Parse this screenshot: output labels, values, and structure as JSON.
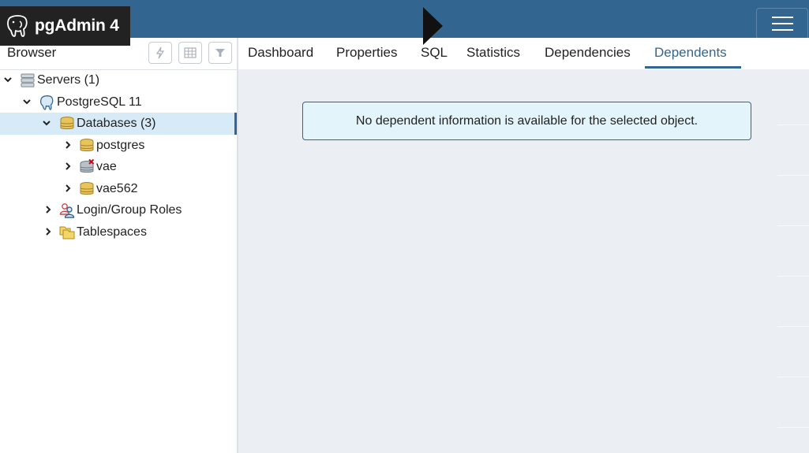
{
  "app": {
    "name": "pgAdmin 4",
    "logo_icon": "elephant-icon",
    "colors": {
      "header": "#326690",
      "brand_bg": "#222222",
      "selected_row": "#d6eaf8",
      "alert_bg": "#e4f4fb"
    }
  },
  "browser": {
    "title": "Browser",
    "toolbar": [
      {
        "name": "query-tool-button",
        "icon": "lightning-icon"
      },
      {
        "name": "view-data-button",
        "icon": "table-icon"
      },
      {
        "name": "filter-button",
        "icon": "filter-icon"
      }
    ],
    "tree": [
      {
        "label": "Servers (1)",
        "icon": "servers-icon",
        "expanded": true
      },
      {
        "label": "PostgreSQL 11",
        "icon": "postgres-server-icon",
        "expanded": true
      },
      {
        "label": "Databases (3)",
        "icon": "databases-icon",
        "expanded": true,
        "selected": true
      },
      {
        "label": "postgres",
        "icon": "database-icon",
        "expanded": false
      },
      {
        "label": "vae",
        "icon": "database-disconnected-icon",
        "expanded": false
      },
      {
        "label": "vae562",
        "icon": "database-icon",
        "expanded": false
      },
      {
        "label": "Login/Group Roles",
        "icon": "roles-icon",
        "expanded": false
      },
      {
        "label": "Tablespaces",
        "icon": "tablespaces-icon",
        "expanded": false
      }
    ]
  },
  "tabs": [
    {
      "label": "Dashboard"
    },
    {
      "label": "Properties"
    },
    {
      "label": "SQL"
    },
    {
      "label": "Statistics"
    },
    {
      "label": "Dependencies"
    },
    {
      "label": "Dependents",
      "active": true
    }
  ],
  "main": {
    "message": "No dependent information is available for the selected object."
  }
}
